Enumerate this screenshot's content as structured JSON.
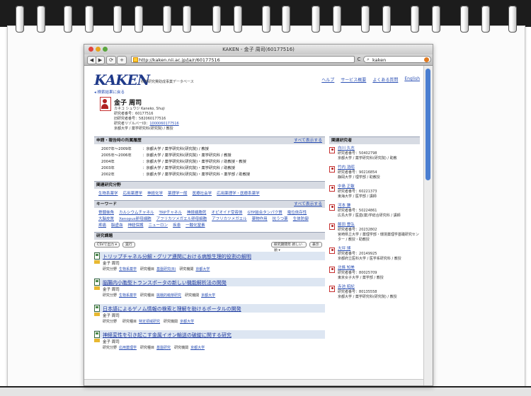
{
  "browser": {
    "title": "KAKEN - 金子 周司(60177516)",
    "url": "http://kaken.nii.ac.jp/ja/r/60177516",
    "search_value": "kaken",
    "search_icon": "magnifier-icon",
    "reload_label": "C",
    "nav_back": "◀",
    "nav_forward": "▶",
    "add_label": "+"
  },
  "site": {
    "logo": "KAKEN",
    "logo_sub": "科学研究費助成事業データベース",
    "back_link": "◂ 検索結果に戻る",
    "top_links": [
      "ヘルプ",
      "サービス概要",
      "よくある質問",
      "English"
    ]
  },
  "person": {
    "name": "金子 周司",
    "name_kana": "カネコ シュウジ Kaneko, Shuji",
    "researcher_id_label": "研究者番号：",
    "researcher_id": "60177516",
    "old_id_label": "旧研究者番号：",
    "old_id": "582060177516",
    "resolver_label": "研究者リゾルバーID：",
    "resolver_id": "1000060177516",
    "affiliation": "京都大学 / 薬学研究科(研究院) / 教授"
  },
  "history": {
    "heading": "申請・報告時の所属履歴",
    "more": "すべて表示する",
    "rows": [
      {
        "year": "2007年～2009年",
        "text": "京都大学 / 薬学研究科(研究院) / 教授"
      },
      {
        "year": "2005年～2006年",
        "text": "京都大学 / 薬学研究科(研究院)・薬学研究科 / 教授"
      },
      {
        "year": "2004年",
        "text": "京都大学 / 薬学研究科(研究院)・薬学研究科 / 助教授・教授"
      },
      {
        "year": "2003年",
        "text": "京都大学 / 薬学研究科(研究院)・薬学研究科 / 助教授"
      },
      {
        "year": "2002年",
        "text": "京都大学 / 薬学研究科(研究院)・薬学研究科・薬学部 / 助教授"
      }
    ]
  },
  "fields": {
    "heading": "関連研究分野",
    "items": [
      "生物系薬学",
      "応用薬理学",
      "神経化学",
      "薬理学一般",
      "医療社会学",
      "応用薬理学・医療系薬学"
    ]
  },
  "keywords": {
    "heading": "キーワード",
    "more": "すべて表示する",
    "items": [
      "脊髄後角",
      "カルシウムチャネル",
      "TRPチャネル",
      "神経細胞死",
      "オピオイド受容体",
      "GTP結合タンパク質",
      "電位依存性",
      "大脳皮質",
      "Xenopus卵母細胞",
      "アフリカツメガエル卵母細胞",
      "アフリカツメガエル",
      "薬物作用",
      "抗うつ薬",
      "生体防御",
      "疼痛",
      "脳虚血",
      "神経保護",
      "ニューロン",
      "疾患",
      "一酸化窒素"
    ]
  },
  "projects": {
    "heading": "研究課題",
    "csv_select": "CSVで出力",
    "exec_button": "実行",
    "sort_select": "研究期間年 新しい順",
    "show_button": "表示",
    "field_label": "研究分野",
    "item_label": "研究種目",
    "org_label": "研究機関",
    "items": [
      {
        "title": "トリップチャネル分解・グリア連関における病態生理的役割の解明",
        "person": "金子 周司",
        "field": "生物系薬学",
        "item": "基盤研究(B)",
        "org": "京都大学"
      },
      {
        "title": "脳腸内小胞型トランスポータの新しい機能解析法の開発",
        "person": "金子 周司",
        "field": "生物系薬学",
        "item": "挑戦的萌芽研究",
        "org": "京都大学"
      },
      {
        "title": "日本語によるゲノム情報の検索と理解を助けるポータルの開発",
        "person": "金子 周司",
        "field": "",
        "item": "特定領域研究",
        "org": "京都大学"
      },
      {
        "title": "神経変性を引き起こす金属イオン輸送の破綻に関する研究",
        "person": "金子 周司",
        "field": "応用薬理学",
        "item": "基盤研究",
        "org": "京都大学"
      }
    ]
  },
  "related": {
    "heading": "関連研究者",
    "id_label": "研究者番号：",
    "items": [
      {
        "name": "白川 久志",
        "id": "50402798",
        "aff": "京都大学 / 薬学研究科(研究院) / 助教"
      },
      {
        "name": "竹内 浩昭",
        "id": "90216854",
        "aff": "静岡大学 / 理学部 / 助教授"
      },
      {
        "name": "中島 正敏",
        "id": "60221373",
        "aff": "東海大学 / 医学部 / 講師"
      },
      {
        "name": "河本 謙",
        "id": "50224861",
        "aff": "広島大学 / 医歯(薬)学総合研究科 / 講師"
      },
      {
        "name": "飯田 豊弘",
        "id": "20232802",
        "aff": "宮崎県立大学 / 薬理学部・環境薬理学基礎研究センター / 教授・助教授"
      },
      {
        "name": "大坪 博",
        "id": "20149925",
        "aff": "京都府立医科大学 / 医学系研究科 / 教授"
      },
      {
        "name": "北條 知美",
        "id": "80025709",
        "aff": "東京女子大学 / 薬学部 / 教授"
      },
      {
        "name": "赤池 昭紀",
        "id": "80135558",
        "aff": "京都大学 / 薬学研究科(研究院) / 教授"
      }
    ]
  }
}
